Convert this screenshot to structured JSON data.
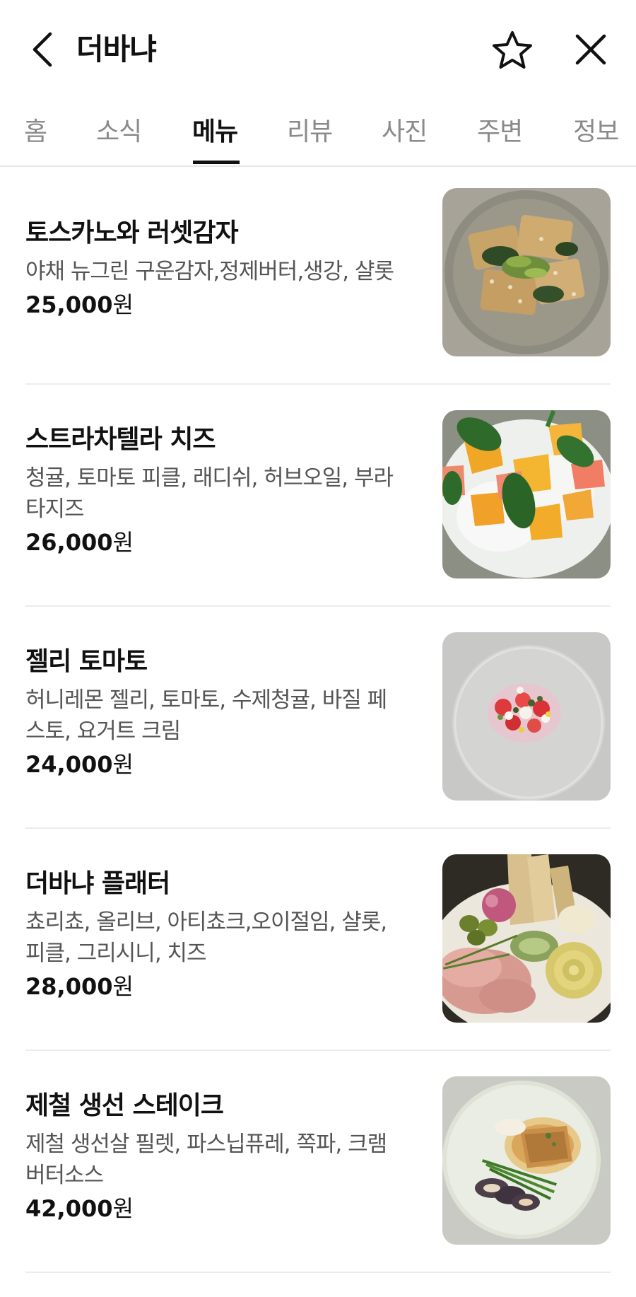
{
  "header": {
    "title": "더바냐",
    "back_icon": "chevron-left-icon",
    "favorite_icon": "star-outline-icon",
    "close_icon": "close-icon"
  },
  "tabs": [
    {
      "label": "홈",
      "active": false
    },
    {
      "label": "소식",
      "active": false
    },
    {
      "label": "메뉴",
      "active": true
    },
    {
      "label": "리뷰",
      "active": false
    },
    {
      "label": "사진",
      "active": false
    },
    {
      "label": "주변",
      "active": false
    },
    {
      "label": "정보",
      "active": false
    }
  ],
  "menu": {
    "items": [
      {
        "name": "토스카노와 러셋감자",
        "desc_lines": [
          "야채 뉴그린 구운감자,정제버터,생강, 샬롯"
        ],
        "price": "25,000",
        "currency": "원"
      },
      {
        "name": "스트라차텔라 치즈",
        "desc_lines": [
          "청귤, 토마토 피클, 래디쉬, 허브오일, 부라",
          "타지즈"
        ],
        "price": "26,000",
        "currency": "원"
      },
      {
        "name": "젤리 토마토",
        "desc_lines": [
          "허니레몬 젤리, 토마토, 수제청귤, 바질 페",
          "스토, 요거트 크림"
        ],
        "price": "24,000",
        "currency": "원"
      },
      {
        "name": "더바냐 플래터",
        "desc_lines": [
          "쵸리쵸, 올리브, 아티쵸크,오이절임, 샬롯,",
          "피클, 그리시니, 치즈"
        ],
        "price": "28,000",
        "currency": "원"
      },
      {
        "name": "제철 생선 스테이크",
        "desc_lines": [
          "제철 생선살 필렛, 파스닙퓨레, 쪽파, 크램",
          "버터소스"
        ],
        "price": "42,000",
        "currency": "원"
      }
    ]
  },
  "colors": {
    "text_primary": "#111111",
    "text_secondary": "#555555",
    "tab_inactive": "#8a8a8a",
    "divider": "#ececec"
  }
}
